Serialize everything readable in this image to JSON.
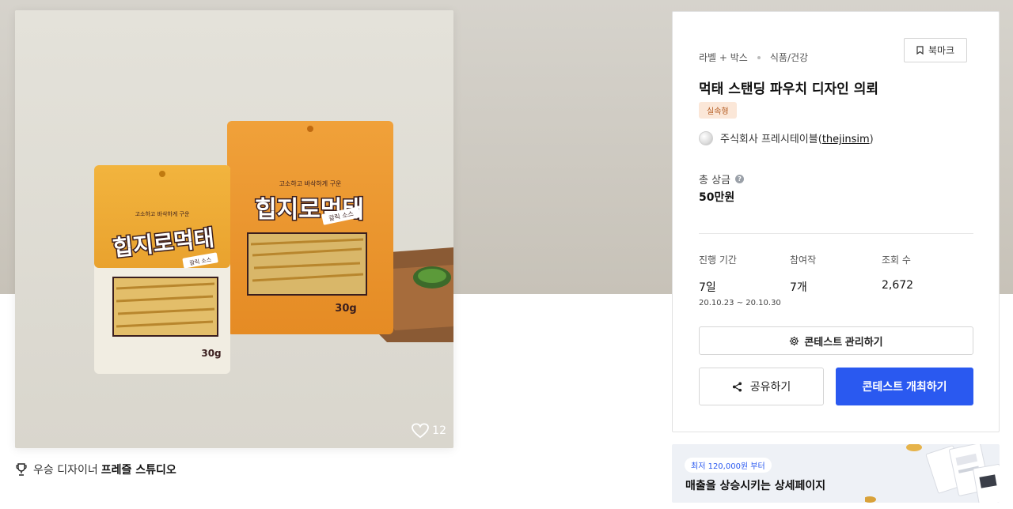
{
  "image": {
    "likes": "12",
    "package": {
      "front_title": "힙지로먹태",
      "front_sub": "고소하고 바삭하게 구운",
      "front_flavor": "갈릭 소스",
      "front_weight": "30g",
      "back_title": "힙지로먹태",
      "back_sub": "고소하고 바삭하게 구운",
      "back_flavor": "갈릭 소스",
      "back_weight": "30g"
    }
  },
  "award": {
    "label": "우승 디자이너",
    "designer": "프레즐 스튜디오"
  },
  "contest": {
    "category_1": "라벨 + 박스",
    "category_2": "식품/건강",
    "bookmark_label": "북마크",
    "title": "먹태 스탠딩 파우치 디자인 의뢰",
    "badge": "실속형",
    "owner_name": "주식회사 프레시테이블",
    "owner_handle": "thejinsim",
    "prize_label": "총 상금",
    "prize_value": "50만원",
    "stats": {
      "period_label": "진행 기간",
      "period_value": "7일",
      "period_dates": "20.10.23 ~ 20.10.30",
      "entries_label": "참여작",
      "entries_value": "7개",
      "views_label": "조회 수",
      "views_value": "2,672"
    },
    "manage_label": "콘테스트 관리하기",
    "share_label": "공유하기",
    "host_label": "콘테스트 개최하기"
  },
  "ad": {
    "pill": "최저 120,000원 부터",
    "headline": "매출을 상승시키는 상세페이지"
  },
  "colors": {
    "primary": "#2a59f0",
    "badge_bg": "#fbe7d8",
    "badge_text": "#b35a1f",
    "hero_bg": "#cfcbc3"
  }
}
